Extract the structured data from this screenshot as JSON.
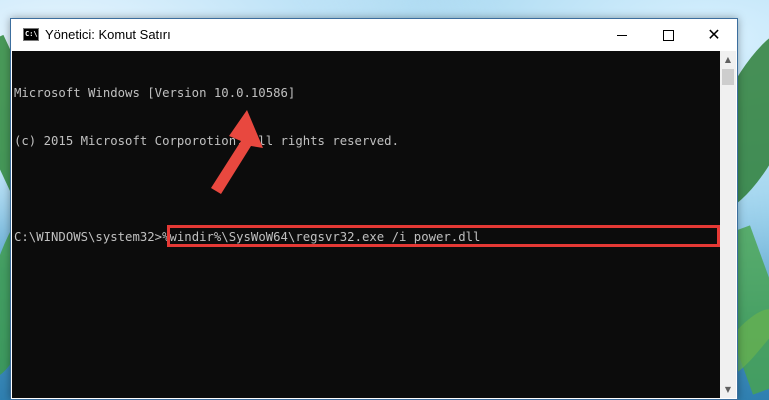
{
  "window": {
    "title": "Yönetici: Komut Satırı",
    "icon_label": "C:\\"
  },
  "controls": {
    "minimize_icon": "minimize-icon",
    "maximize_icon": "maximize-icon",
    "close_icon": "close-icon",
    "close_glyph": "✕"
  },
  "console": {
    "lines": [
      "Microsoft Windows [Version 10.0.10586]",
      "(c) 2015 Microsoft Corporotion. All rights reserved.",
      ""
    ],
    "prompt": "C:\\WINDOWS\\system32>",
    "command": "%windir%\\SysWoW64\\regsvr32.exe /i power.dll"
  },
  "scrollbar": {
    "up_glyph": "▲",
    "down_glyph": "▼"
  },
  "colors": {
    "highlight": "#e53935",
    "arrow": "#e8483f",
    "console_bg": "#0c0c0c",
    "console_text": "#c0c0c0"
  }
}
